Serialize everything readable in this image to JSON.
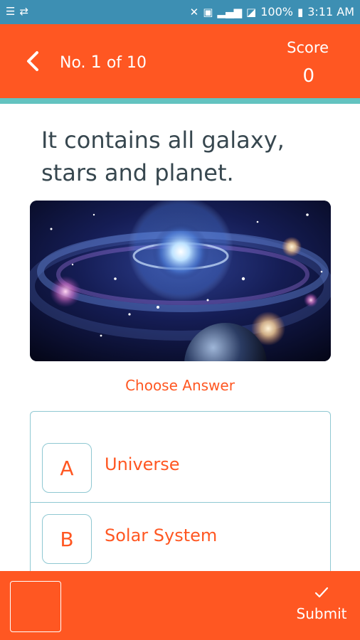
{
  "status_bar": {
    "battery": "100%",
    "time": "3:11 AM",
    "icons": [
      "notification-list-icon",
      "usb-icon",
      "mute-icon",
      "nfc-icon",
      "signal-icon",
      "signal-boxed-icon",
      "battery-icon"
    ]
  },
  "header": {
    "title_prefix": "No.",
    "question_number": "1",
    "title_suffix": "of 10",
    "score_label": "Score",
    "score_value": "0",
    "back_icon": "chevron-left-icon"
  },
  "question": {
    "text": "It contains all galaxy, stars and planet."
  },
  "image": {
    "icon": "galaxy-image"
  },
  "choose_label": "Choose Answer",
  "answers": [
    {
      "letter": "A",
      "text": "Universe"
    },
    {
      "letter": "B",
      "text": "Solar System"
    }
  ],
  "bottom": {
    "submit_label": "Submit",
    "submit_icon": "check-icon"
  },
  "colors": {
    "accent": "#ff5722",
    "status_bar": "#3d8fb3",
    "divider": "#63c3c0",
    "border": "#8fc8d2",
    "question_text": "#37474f"
  }
}
